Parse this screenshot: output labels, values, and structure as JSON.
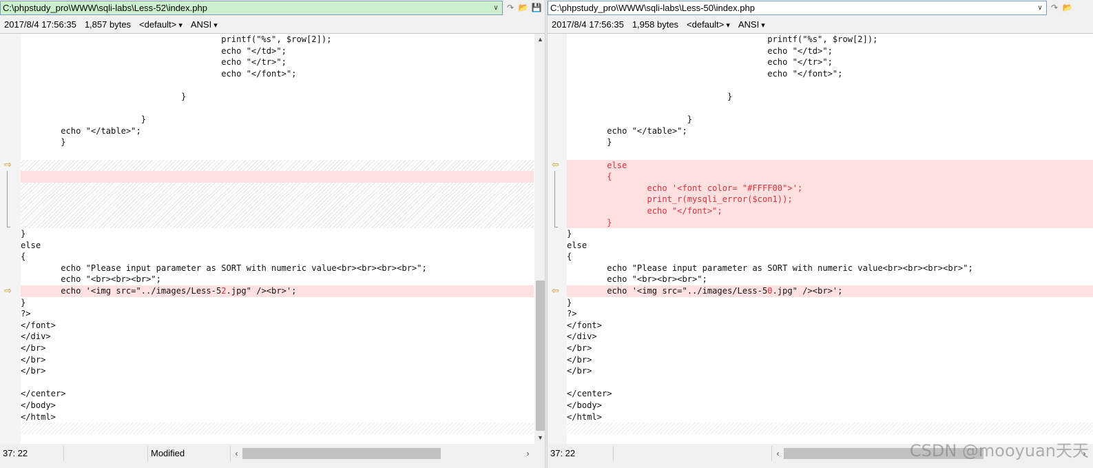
{
  "left": {
    "path": "C:\\phpstudy_pro\\WWW\\sqli-labs\\Less-52\\index.php",
    "timestamp": "2017/8/4 17:56:35",
    "size": "1,857 bytes",
    "syntax": "<default>",
    "encoding": "ANSI",
    "status_position": "37: 22",
    "status_state": "Modified",
    "lines": [
      {
        "text": "                                        printf(\"%s\", $row[2]);",
        "type": "normal"
      },
      {
        "text": "                                        echo \"</td>\";",
        "type": "normal"
      },
      {
        "text": "                                        echo \"</tr>\";",
        "type": "normal"
      },
      {
        "text": "                                        echo \"</font>\";",
        "type": "normal"
      },
      {
        "text": "",
        "type": "normal"
      },
      {
        "text": "                                }",
        "type": "normal"
      },
      {
        "text": "",
        "type": "normal"
      },
      {
        "text": "                        }",
        "type": "normal"
      },
      {
        "text": "        echo \"</table>\";",
        "type": "normal"
      },
      {
        "text": "        }",
        "type": "normal"
      },
      {
        "text": "",
        "type": "normal"
      },
      {
        "text": "",
        "type": "hatch"
      },
      {
        "text": "",
        "type": "diff"
      },
      {
        "text": "",
        "type": "hatch"
      },
      {
        "text": "",
        "type": "hatch"
      },
      {
        "text": "",
        "type": "hatch"
      },
      {
        "text": "",
        "type": "hatch"
      },
      {
        "text": "}",
        "type": "normal"
      },
      {
        "text": "else",
        "type": "normal"
      },
      {
        "text": "{",
        "type": "normal"
      },
      {
        "text": "        echo \"Please input parameter as SORT with numeric value<br><br><br><br>\";",
        "type": "normal"
      },
      {
        "text": "        echo \"<br><br><br>\";",
        "type": "normal"
      },
      {
        "pre": "        echo '<img src=\"../images/Less-5",
        "hl": "2",
        "post": ".jpg\" /><br>';",
        "type": "diffhl"
      },
      {
        "text": "}",
        "type": "normal"
      },
      {
        "text": "?>",
        "type": "normal"
      },
      {
        "text": "</font>",
        "type": "normal"
      },
      {
        "text": "</div>",
        "type": "normal"
      },
      {
        "text": "</br>",
        "type": "normal"
      },
      {
        "text": "</br>",
        "type": "normal"
      },
      {
        "text": "</br>",
        "type": "normal"
      },
      {
        "text": "",
        "type": "normal"
      },
      {
        "text": "</center>",
        "type": "normal"
      },
      {
        "text": "</body>",
        "type": "normal"
      },
      {
        "text": "</html>",
        "type": "normal"
      },
      {
        "text": "",
        "type": "tailhatch"
      }
    ]
  },
  "right": {
    "path": "C:\\phpstudy_pro\\WWW\\sqli-labs\\Less-50\\index.php",
    "timestamp": "2017/8/4 17:56:35",
    "size": "1,958 bytes",
    "syntax": "<default>",
    "encoding": "ANSI",
    "status_position": "37: 22",
    "lines": [
      {
        "text": "                                        printf(\"%s\", $row[2]);",
        "type": "normal"
      },
      {
        "text": "                                        echo \"</td>\";",
        "type": "normal"
      },
      {
        "text": "                                        echo \"</tr>\";",
        "type": "normal"
      },
      {
        "text": "                                        echo \"</font>\";",
        "type": "normal"
      },
      {
        "text": "",
        "type": "normal"
      },
      {
        "text": "                                }",
        "type": "normal"
      },
      {
        "text": "",
        "type": "normal"
      },
      {
        "text": "                        }",
        "type": "normal"
      },
      {
        "text": "        echo \"</table>\";",
        "type": "normal"
      },
      {
        "text": "        }",
        "type": "normal"
      },
      {
        "text": "",
        "type": "normal"
      },
      {
        "text": "        else",
        "type": "diffred"
      },
      {
        "text": "        {",
        "type": "diffred"
      },
      {
        "text": "                echo '<font color= \"#FFFF00\">';",
        "type": "diffred"
      },
      {
        "text": "                print_r(mysqli_error($con1));",
        "type": "diffred"
      },
      {
        "text": "                echo \"</font>\";",
        "type": "diffred"
      },
      {
        "text": "        }",
        "type": "diffred"
      },
      {
        "text": "}",
        "type": "normal"
      },
      {
        "text": "else",
        "type": "normal"
      },
      {
        "text": "{",
        "type": "normal"
      },
      {
        "text": "        echo \"Please input parameter as SORT with numeric value<br><br><br><br>\";",
        "type": "normal"
      },
      {
        "text": "        echo \"<br><br><br>\";",
        "type": "normal"
      },
      {
        "pre": "        echo '<img src=\"../images/Less-5",
        "hl": "0",
        "post": ".jpg\" /><br>';",
        "type": "diffhl"
      },
      {
        "text": "}",
        "type": "normal"
      },
      {
        "text": "?>",
        "type": "normal"
      },
      {
        "text": "</font>",
        "type": "normal"
      },
      {
        "text": "</div>",
        "type": "normal"
      },
      {
        "text": "</br>",
        "type": "normal"
      },
      {
        "text": "</br>",
        "type": "normal"
      },
      {
        "text": "</br>",
        "type": "normal"
      },
      {
        "text": "",
        "type": "normal"
      },
      {
        "text": "</center>",
        "type": "normal"
      },
      {
        "text": "</body>",
        "type": "normal"
      },
      {
        "text": "</html>",
        "type": "normal"
      },
      {
        "text": "",
        "type": "tailhatch"
      }
    ]
  },
  "icons": {
    "dropdown": "∨",
    "next": "↷",
    "folder": "📂",
    "save": "💾",
    "marker": "⇨",
    "marker_right": "⇦",
    "scroll_up": "▲",
    "scroll_down": "▼",
    "scroll_left": "‹",
    "scroll_right": "›"
  },
  "watermark": "CSDN @mooyuan天天"
}
